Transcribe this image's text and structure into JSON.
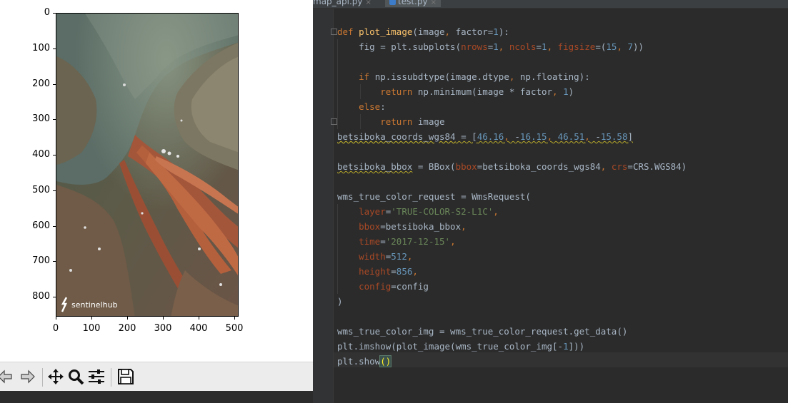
{
  "editor": {
    "tabs": [
      {
        "label": "map_api.py",
        "close": "×"
      },
      {
        "label": "test.py",
        "close": "×"
      }
    ],
    "lines": [
      "def plot_image(image, factor=1):",
      "    fig = plt.subplots(nrows=1, ncols=1, figsize=(15, 7))",
      "",
      "    if np.issubdtype(image.dtype, np.floating):",
      "        return np.minimum(image * factor, 1)",
      "    else:",
      "        return image",
      "betsiboka_coords_wgs84 = [46.16, -16.15, 46.51, -15.58]",
      "",
      "betsiboka_bbox = BBox(bbox=betsiboka_coords_wgs84, crs=CRS.WGS84)",
      "",
      "wms_true_color_request = WmsRequest(",
      "    layer='TRUE-COLOR-S2-L1C',",
      "    bbox=betsiboka_bbox,",
      "    time='2017-12-15',",
      "    width=512,",
      "    height=856,",
      "    config=config",
      ")",
      "",
      "wms_true_color_img = wms_true_color_request.get_data()",
      "plt.imshow(plot_image(wms_true_color_img[-1]))",
      "plt.show()"
    ],
    "colors": {
      "background": "#2b2b2b",
      "keyword": "#cc7832",
      "function": "#ffc66d",
      "number": "#6897bb",
      "string": "#6a8759",
      "param": "#aa4926",
      "text": "#a9b7c6"
    }
  },
  "figure": {
    "image_watermark": "sentinelhub",
    "x_tick_labels": [
      "0",
      "100",
      "200",
      "300",
      "400",
      "500"
    ],
    "y_tick_labels": [
      "0",
      "100",
      "200",
      "300",
      "400",
      "500",
      "600",
      "700",
      "800"
    ],
    "xlim": [
      0,
      512
    ],
    "ylim": [
      856,
      0
    ],
    "toolbar": {
      "buttons": [
        "back-icon",
        "forward-icon",
        "pan-icon",
        "zoom-icon",
        "configure-subplots-icon",
        "save-icon"
      ]
    }
  }
}
